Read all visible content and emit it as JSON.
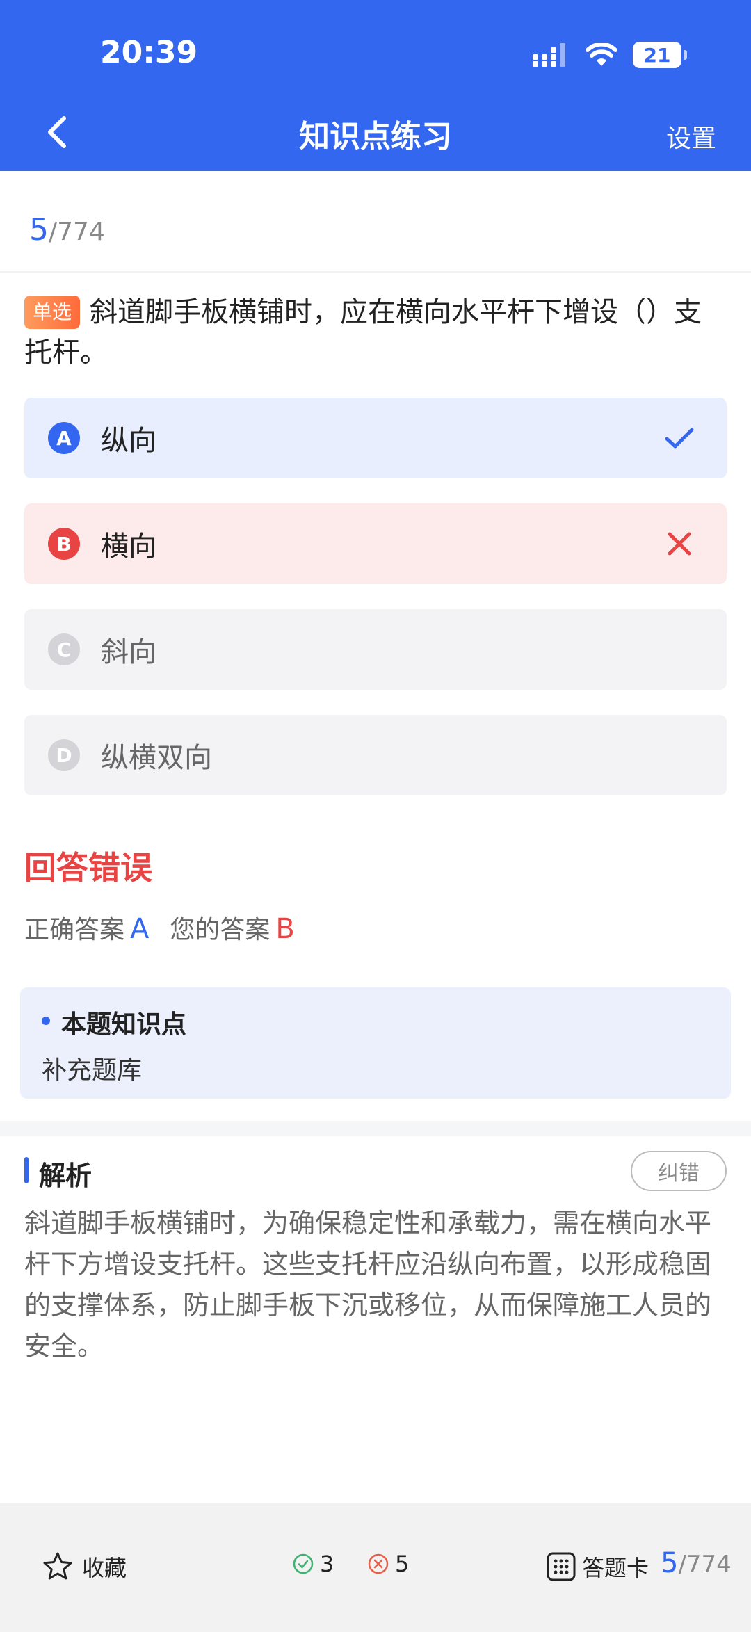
{
  "status_bar": {
    "time": "20:39",
    "battery": "21"
  },
  "header": {
    "title": "知识点练习",
    "settings_label": "设置"
  },
  "progress": {
    "current": "5",
    "total": "/774"
  },
  "question": {
    "type_tag": "单选",
    "text": "斜道脚手板横铺时，应在横向水平杆下增设（）支托杆。"
  },
  "options": [
    {
      "key": "A",
      "label": "纵向",
      "state": "correct"
    },
    {
      "key": "B",
      "label": "横向",
      "state": "wrong"
    },
    {
      "key": "C",
      "label": "斜向",
      "state": "plain"
    },
    {
      "key": "D",
      "label": "纵横双向",
      "state": "plain"
    }
  ],
  "result": {
    "title": "回答错误",
    "correct_label": "正确答案",
    "correct_value": "A",
    "yours_label": "您的答案",
    "yours_value": "B"
  },
  "knowledge": {
    "title": "本题知识点",
    "content": "补充题库"
  },
  "analysis": {
    "title": "解析",
    "correction_label": "纠错",
    "text": "斜道脚手板横铺时，为确保稳定性和承载力，需在横向水平杆下方增设支托杆。这些支托杆应沿纵向布置，以形成稳固的支撑体系，防止脚手板下沉或移位，从而保障施工人员的安全。"
  },
  "bottom_bar": {
    "favorite_label": "收藏",
    "right_count": "3",
    "wrong_count": "5",
    "answer_card_label": "答题卡",
    "progress_current": "5",
    "progress_total": "/774"
  },
  "colors": {
    "primary": "#3467f0",
    "error": "#e84444",
    "correct_bg": "#e8eefd",
    "wrong_bg": "#fdebeb",
    "neutral_bg": "#f3f3f5",
    "tag_orange": "#ff7a45",
    "success_green": "#3cb371"
  },
  "icons": {
    "back": "chevron-left-icon",
    "correct_mark": "check-icon",
    "wrong_mark": "close-icon",
    "favorite": "star-icon",
    "right": "check-circle-icon",
    "wrong": "x-circle-icon",
    "answer_card": "grid-icon"
  }
}
